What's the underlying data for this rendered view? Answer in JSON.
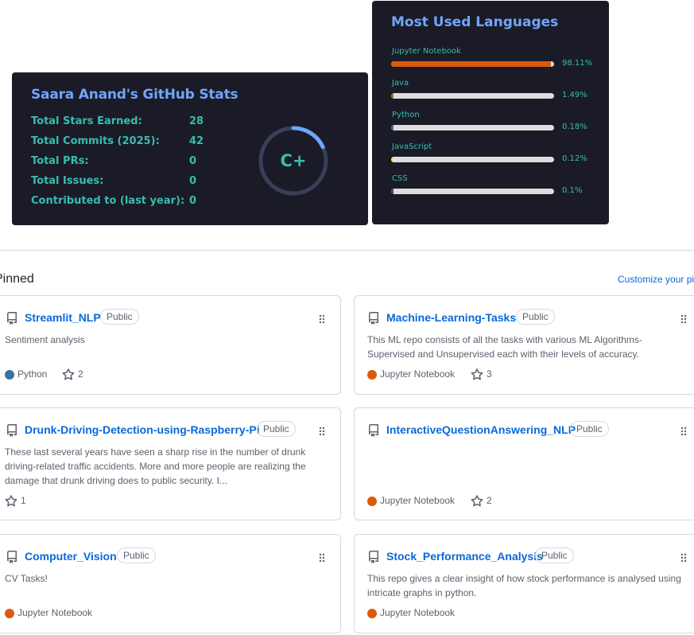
{
  "stats_card": {
    "title": "Saara Anand's GitHub Stats",
    "rows": [
      {
        "label": "Total Stars Earned:",
        "value": "28"
      },
      {
        "label": "Total Commits (2025):",
        "value": "42"
      },
      {
        "label": "Total PRs:",
        "value": "0"
      },
      {
        "label": "Total Issues:",
        "value": "0"
      },
      {
        "label": "Contributed to (last year):",
        "value": "0"
      }
    ],
    "rank": "C+",
    "rank_progress": 0.18,
    "colors": {
      "background": "#1a1b27",
      "title": "#70a5fd",
      "text": "#38bdae",
      "ring": "#70a5fd"
    }
  },
  "languages_card": {
    "title": "Most Used Languages",
    "languages": [
      {
        "name": "Jupyter Notebook",
        "percent": "98.11%",
        "value": 98.11,
        "color": "#da5b0b"
      },
      {
        "name": "Java",
        "percent": "1.49%",
        "value": 1.49,
        "color": "#b07219"
      },
      {
        "name": "Python",
        "percent": "0.18%",
        "value": 0.18,
        "color": "#3572a5"
      },
      {
        "name": "JavaScript",
        "percent": "0.12%",
        "value": 0.12,
        "color": "#f1e05a"
      },
      {
        "name": "CSS",
        "percent": "0.1%",
        "value": 0.1,
        "color": "#563d7c"
      }
    ]
  },
  "pinned": {
    "heading": "Pinned",
    "customize_link": "Customize your pins",
    "repos": [
      {
        "name": "Streamlit_NLP",
        "visibility": "Public",
        "description": "Sentiment analysis",
        "language": "Python",
        "language_color": "#3572a5",
        "stars": "2"
      },
      {
        "name": "Machine-Learning-Tasks",
        "visibility": "Public",
        "description": "This ML repo consists of all the tasks with various ML Algorithms- Supervised and Unsupervised each with their levels of accuracy.",
        "language": "Jupyter Notebook",
        "language_color": "#da5b0b",
        "stars": "3"
      },
      {
        "name": "Drunk-Driving-Detection-using-Raspberry-Pi",
        "visibility": "Public",
        "description": "These last several years have seen a sharp rise in the number of drunk driving-related traffic accidents. More and more people are realizing the damage that drunk driving does to public security. I...",
        "language": "",
        "language_color": "",
        "stars": "1"
      },
      {
        "name": "InteractiveQuestionAnswering_NLP",
        "visibility": "Public",
        "description": "",
        "language": "Jupyter Notebook",
        "language_color": "#da5b0b",
        "stars": "2"
      },
      {
        "name": "Computer_Vision",
        "visibility": "Public",
        "description": "CV Tasks!",
        "language": "Jupyter Notebook",
        "language_color": "#da5b0b",
        "stars": ""
      },
      {
        "name": "Stock_Performance_Analysis",
        "visibility": "Public",
        "description": "This repo gives a clear insight of how stock performance is analysed using intricate graphs in python.",
        "language": "Jupyter Notebook",
        "language_color": "#da5b0b",
        "stars": ""
      }
    ]
  }
}
